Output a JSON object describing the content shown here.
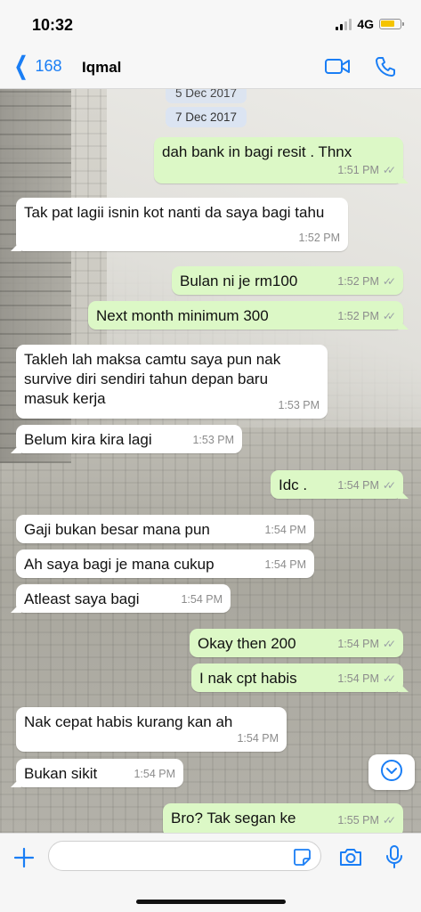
{
  "status_bar": {
    "time": "10:32",
    "network": "4G"
  },
  "header": {
    "back_count": "168",
    "contact_name": "Iqmal"
  },
  "dates": [
    "5 Dec 2017",
    "7 Dec 2017"
  ],
  "messages": [
    {
      "dir": "out",
      "text": "dah bank in bagi resit . Thnx",
      "time": "1:51 PM"
    },
    {
      "dir": "in",
      "text": "Tak pat lagii isnin kot nanti da saya bagi tahu",
      "time": "1:52 PM"
    },
    {
      "dir": "out",
      "text": "Bulan ni je rm100",
      "time": "1:52 PM"
    },
    {
      "dir": "out",
      "text": "Next month minimum 300",
      "time": "1:52 PM"
    },
    {
      "dir": "in",
      "text": "Takleh lah maksa camtu saya pun nak survive diri sendiri tahun depan baru masuk kerja",
      "time": "1:53 PM"
    },
    {
      "dir": "in",
      "text": "Belum kira kira lagi",
      "time": "1:53 PM"
    },
    {
      "dir": "out",
      "text": "Idc .",
      "time": "1:54 PM"
    },
    {
      "dir": "in",
      "text": "Gaji bukan besar mana pun",
      "time": "1:54 PM"
    },
    {
      "dir": "in",
      "text": "Ah saya bagi je mana cukup",
      "time": "1:54 PM"
    },
    {
      "dir": "in",
      "text": "Atleast saya bagi",
      "time": "1:54 PM"
    },
    {
      "dir": "out",
      "text": "Okay then 200",
      "time": "1:54 PM"
    },
    {
      "dir": "out",
      "text": "I nak cpt habis",
      "time": "1:54 PM"
    },
    {
      "dir": "in",
      "text": "Nak cepat habis kurang kan ah",
      "time": "1:54 PM"
    },
    {
      "dir": "in",
      "text": "Bukan sikit",
      "time": "1:54 PM"
    },
    {
      "dir": "out",
      "text": "Bro? Tak segan ke",
      "time": "1:55 PM"
    }
  ],
  "icons": {
    "video_call": "video-camera-icon",
    "voice_call": "phone-icon",
    "attach": "plus-icon",
    "sticker": "sticker-icon",
    "camera": "camera-icon",
    "mic": "microphone-icon",
    "scroll": "chevron-down-icon"
  },
  "colors": {
    "accent": "#1a7ef5",
    "outgoing_bubble": "#dcf8c6",
    "incoming_bubble": "#ffffff",
    "date_pill": "#dbe4f2"
  }
}
